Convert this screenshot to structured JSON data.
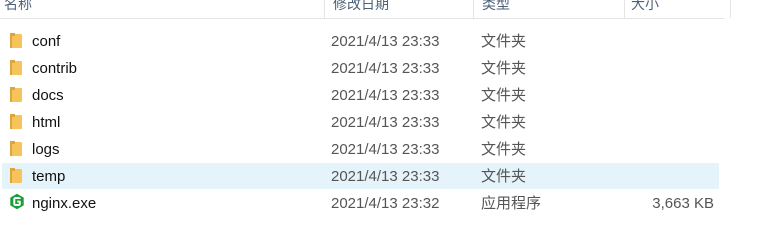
{
  "columns": {
    "name": "名称",
    "date": "修改日期",
    "type": "类型",
    "size": "大小"
  },
  "colors": {
    "folder": "#f6c45a",
    "folder_dark": "#dba63c",
    "selected_row": "#e5f3fb",
    "exe_green": "#1a9e3a"
  },
  "files": [
    {
      "name": "conf",
      "date": "2021/4/13 23:33",
      "type": "文件夹",
      "size": "",
      "icon": "folder-icon"
    },
    {
      "name": "contrib",
      "date": "2021/4/13 23:33",
      "type": "文件夹",
      "size": "",
      "icon": "folder-icon"
    },
    {
      "name": "docs",
      "date": "2021/4/13 23:33",
      "type": "文件夹",
      "size": "",
      "icon": "folder-icon"
    },
    {
      "name": "html",
      "date": "2021/4/13 23:33",
      "type": "文件夹",
      "size": "",
      "icon": "folder-icon"
    },
    {
      "name": "logs",
      "date": "2021/4/13 23:33",
      "type": "文件夹",
      "size": "",
      "icon": "folder-icon"
    },
    {
      "name": "temp",
      "date": "2021/4/13 23:33",
      "type": "文件夹",
      "size": "",
      "icon": "folder-icon",
      "selected": true
    },
    {
      "name": "nginx.exe",
      "date": "2021/4/13 23:32",
      "type": "应用程序",
      "size": "3,663 KB",
      "icon": "nginx-exe-icon"
    }
  ]
}
